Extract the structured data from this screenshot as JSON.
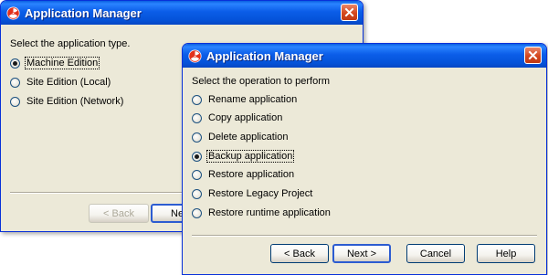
{
  "back_window": {
    "title": "Application Manager",
    "prompt": "Select the application type.",
    "options": [
      {
        "label": "Machine Edition",
        "checked": true
      },
      {
        "label": "Site Edition (Local)",
        "checked": false
      },
      {
        "label": "Site Edition (Network)",
        "checked": false
      }
    ],
    "buttons": {
      "back": "< Back",
      "next": "Ne"
    }
  },
  "front_window": {
    "title": "Application Manager",
    "prompt": "Select the operation to perform",
    "options": [
      {
        "label": "Rename application",
        "checked": false
      },
      {
        "label": "Copy application",
        "checked": false
      },
      {
        "label": "Delete application",
        "checked": false
      },
      {
        "label": "Backup application",
        "checked": true
      },
      {
        "label": "Restore application",
        "checked": false
      },
      {
        "label": "Restore Legacy Project",
        "checked": false
      },
      {
        "label": "Restore runtime application",
        "checked": false
      }
    ],
    "buttons": {
      "back": "< Back",
      "next": "Next >",
      "cancel": "Cancel",
      "help": "Help"
    }
  },
  "icons": {
    "app": "radiation-trefoil-icon",
    "close": "close-icon"
  },
  "colors": {
    "titlebar": "#0553d9",
    "window_bg": "#ece9d8",
    "close_button": "#d4471e",
    "icon_red": "#e3301c"
  }
}
